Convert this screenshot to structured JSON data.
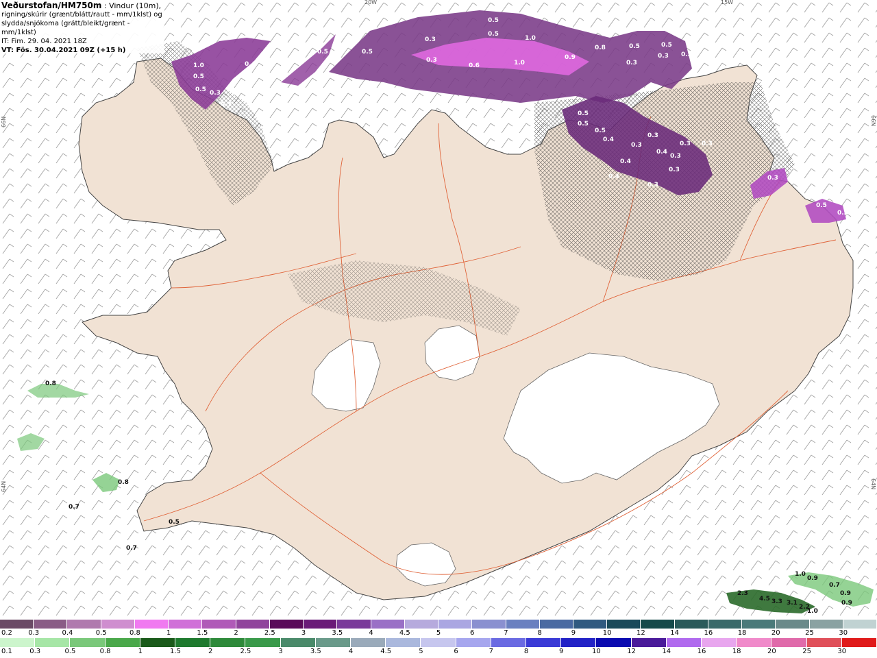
{
  "header": {
    "title": "Veðurstofan/HM750m",
    "desc_line1": ": Vindur (10m),",
    "desc_line2": "rigning/skúrir (grænt/blátt/rautt - mm/1klst) og",
    "desc_line3": "slydda/snjókoma (grátt/bleikt/grænt - mm/1klst)",
    "issue_time": "IT: Fim. 29. 04. 2021 18Z",
    "valid_time": "VT: Fös. 30.04.2021 09Z (+15 h)"
  },
  "coords": {
    "lon_20w": "20W",
    "lon_15w": "15W",
    "lat_66n_left": "66N",
    "lat_66n_right": "66N",
    "lat_64n_left": "64N",
    "lat_64n_right": "64N"
  },
  "snow_values": [
    {
      "t": "0.3"
    },
    {
      "t": "0.5"
    },
    {
      "t": "0.5"
    },
    {
      "t": "1.0"
    },
    {
      "t": "0.9"
    },
    {
      "t": "0.8"
    },
    {
      "t": "0.5"
    },
    {
      "t": "0.5"
    },
    {
      "t": "0.3"
    },
    {
      "t": "0.3"
    },
    {
      "t": "0.6"
    },
    {
      "t": "1.0"
    },
    {
      "t": "0.5"
    },
    {
      "t": "0.5"
    },
    {
      "t": "0.5"
    },
    {
      "t": "0.3"
    },
    {
      "t": "0.5"
    },
    {
      "t": "0.5"
    },
    {
      "t": "0.5"
    },
    {
      "t": "0.4"
    },
    {
      "t": "0.3"
    },
    {
      "t": "0.4"
    },
    {
      "t": "0.3"
    },
    {
      "t": "0.4"
    },
    {
      "t": "0.3"
    },
    {
      "t": "0.3"
    },
    {
      "t": "0.4"
    },
    {
      "t": "0.3"
    },
    {
      "t": "0.3"
    },
    {
      "t": "0.3"
    },
    {
      "t": "0.4"
    },
    {
      "t": "0.5"
    },
    {
      "t": "0.5"
    },
    {
      "t": "0.3"
    },
    {
      "t": "0.3"
    },
    {
      "t": "0.3"
    },
    {
      "t": "0.5"
    },
    {
      "t": "0.3"
    },
    {
      "t": "1.0"
    }
  ],
  "rain_values": [
    {
      "t": "0.8"
    },
    {
      "t": "0.8"
    },
    {
      "t": "0.7"
    },
    {
      "t": "0.7"
    },
    {
      "t": "0.5"
    },
    {
      "t": "1.0"
    },
    {
      "t": "0.9"
    },
    {
      "t": "0.7"
    },
    {
      "t": "0.9"
    },
    {
      "t": "0.9"
    },
    {
      "t": "2.3"
    },
    {
      "t": "4.5"
    },
    {
      "t": "3.3"
    },
    {
      "t": "3.1"
    },
    {
      "t": "2.2"
    },
    {
      "t": "1.0"
    }
  ],
  "scale_snow": {
    "labels": [
      "0.2",
      "0.3",
      "0.4",
      "0.5",
      "0.8",
      "1",
      "1.5",
      "2",
      "2.5",
      "3",
      "3.5",
      "4",
      "4.5",
      "5",
      "6",
      "7",
      "8",
      "9",
      "10",
      "12",
      "14",
      "16",
      "18",
      "20",
      "25",
      "30"
    ],
    "colors": [
      "#6b4a66",
      "#8a5c86",
      "#b07aae",
      "#cf8ecf",
      "#f07af0",
      "#d070d8",
      "#b05ab8",
      "#90449c",
      "#5a0a5a",
      "#6a1a78",
      "#7a3a9a",
      "#9a70c6",
      "#b6aadd",
      "#aaa6e2",
      "#8a90d0",
      "#6a80c0",
      "#4a6aa2",
      "#305a80",
      "#1a4a5a",
      "#154a4a",
      "#2a5a5a",
      "#3a6a6a",
      "#4a7a7a",
      "#6a8a8a",
      "#8aa2a2",
      "#c0d2d2"
    ]
  },
  "scale_rain": {
    "labels": [
      "0.1",
      "0.3",
      "0.5",
      "0.8",
      "1",
      "1.5",
      "2",
      "2.5",
      "3",
      "3.5",
      "4",
      "4.5",
      "5",
      "6",
      "7",
      "8",
      "9",
      "10",
      "12",
      "14",
      "16",
      "18",
      "20",
      "25",
      "30"
    ],
    "colors": [
      "#ccf5cc",
      "#a6e6a6",
      "#7ac87a",
      "#4aa84a",
      "#1a5a1a",
      "#1e7a2e",
      "#2e8a3a",
      "#3a9a4a",
      "#4a8a6a",
      "#6a9a8a",
      "#9aaaba",
      "#aab8dd",
      "#c6c6ee",
      "#a6a6ee",
      "#6a6ae2",
      "#3a3ad6",
      "#2222c6",
      "#0a0ab0",
      "#4a1a9a",
      "#b06aee",
      "#e8a6ee",
      "#f08aca",
      "#e06aaa",
      "#e0505a",
      "#e01a1a"
    ]
  }
}
